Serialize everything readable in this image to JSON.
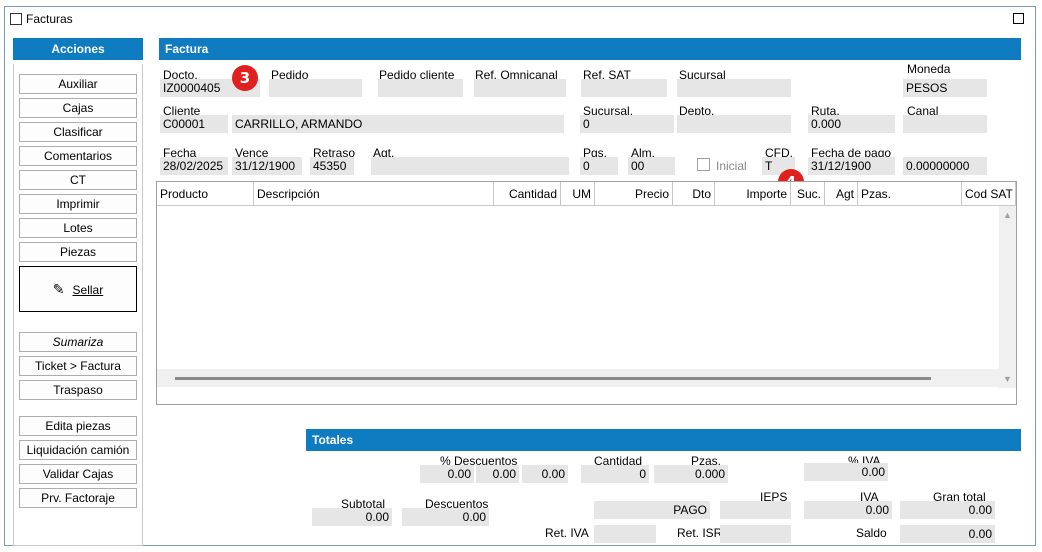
{
  "window": {
    "title": "Facturas"
  },
  "sidebar": {
    "header": "Acciones",
    "buttons": [
      "Auxiliar",
      "Cajas",
      "Clasificar",
      "Comentarios",
      "CT",
      "Imprimir",
      "Lotes",
      "Piezas"
    ],
    "sellar": "Sellar",
    "buttons2": [
      "Sumariza",
      "Ticket > Factura",
      "Traspaso"
    ],
    "buttons3": [
      "Edita piezas",
      "Liquidación camión",
      "Validar Cajas",
      "Prv. Factoraje"
    ]
  },
  "factura": {
    "header": "Factura",
    "docto": {
      "label": "Docto.",
      "value": "IZ0000405"
    },
    "pedido": {
      "label": "Pedido",
      "value": ""
    },
    "pedido_cliente": {
      "label": "Pedido cliente",
      "value": ""
    },
    "ref_omnicanal": {
      "label": "Ref. Omnicanal",
      "value": ""
    },
    "ref_sat": {
      "label": "Ref. SAT",
      "value": ""
    },
    "sucursal": {
      "label": "Sucursal",
      "value": ""
    },
    "moneda": {
      "label": "Moneda",
      "value": "PESOS"
    },
    "cliente": {
      "label": "Cliente",
      "code": "C00001",
      "name": "CARRILLO, ARMANDO"
    },
    "sucursal2": {
      "label": "Sucursal.",
      "value": "0"
    },
    "depto": {
      "label": "Depto.",
      "value": ""
    },
    "ruta": {
      "label": "Ruta.",
      "value": "0.000"
    },
    "canal": {
      "label": "Canal",
      "value": ""
    },
    "fecha": {
      "label": "Fecha",
      "value": "28/02/2025"
    },
    "vence": {
      "label": "Vence",
      "value": "31/12/1900"
    },
    "retraso": {
      "label": "Retraso",
      "value": "45350"
    },
    "agt": {
      "label": "Agt.",
      "value": ""
    },
    "pgs": {
      "label": "Pgs.",
      "value": "0"
    },
    "alm": {
      "label": "Alm.",
      "value": "00"
    },
    "inicial": {
      "label": "Inicial"
    },
    "cfd": {
      "label": "CFD.",
      "value": "T"
    },
    "fecha_pago": {
      "label": "Fecha de pago",
      "value": "31/12/1900"
    },
    "tipo_cambio": {
      "value": "0.00000000"
    }
  },
  "grid": {
    "columns": [
      "Producto",
      "Descripción",
      "Cantidad",
      "UM",
      "Precio",
      "Dto",
      "Importe",
      "Suc.",
      "Agt",
      "Pzas.",
      "Cod SAT"
    ]
  },
  "badges": {
    "b3": "3",
    "b4": "4"
  },
  "totales": {
    "header": "Totales",
    "descuentos_pct": {
      "label": "% Descuentos",
      "v1": "0.00",
      "v2": "0.00",
      "v3": "0.00"
    },
    "cantidad": {
      "label": "Cantidad",
      "value": "0"
    },
    "pzas": {
      "label": "Pzas.",
      "value": "0.000"
    },
    "iva_pct": {
      "label": "% IVA",
      "value": "0.00"
    },
    "subtotal": {
      "label": "Subtotal",
      "value": "0.00"
    },
    "descuentos": {
      "label": "Descuentos",
      "value": "0.00"
    },
    "pago": {
      "value": "PAGO"
    },
    "ieps": {
      "label": "IEPS",
      "value": ""
    },
    "iva": {
      "label": "IVA",
      "value": "0.00"
    },
    "gran_total": {
      "label": "Gran total",
      "value": "0.00"
    },
    "ret_iva": {
      "label": "Ret. IVA",
      "value": ""
    },
    "ret_isr": {
      "label": "Ret. ISR",
      "value": ""
    },
    "saldo": {
      "label": "Saldo",
      "value": "0.00"
    }
  }
}
